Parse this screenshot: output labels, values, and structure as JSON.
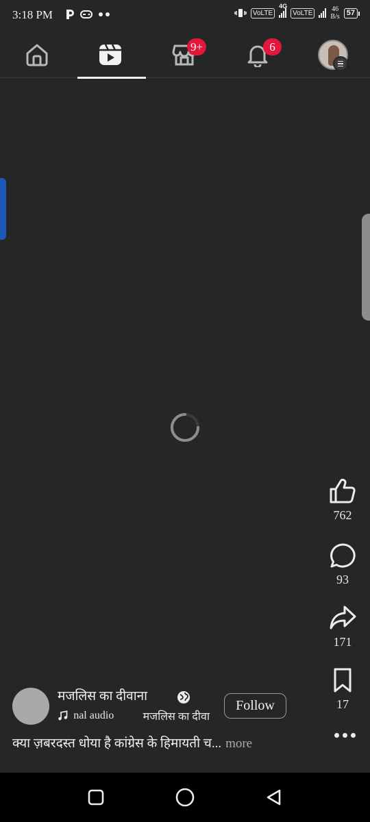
{
  "status_bar": {
    "time": "3:18 PM",
    "volte1": "VoLTE",
    "network_type": "4G",
    "volte2": "VoLTE",
    "speed_value": "46",
    "speed_unit": "B/s",
    "battery": "57"
  },
  "top_nav": {
    "tabs": [
      {
        "name": "home",
        "icon": "home-icon"
      },
      {
        "name": "reels",
        "icon": "reels-icon",
        "active": true
      },
      {
        "name": "marketplace",
        "icon": "marketplace-icon",
        "badge": "9+"
      },
      {
        "name": "notifications",
        "icon": "bell-icon",
        "badge": "6"
      },
      {
        "name": "profile",
        "icon": "avatar"
      }
    ]
  },
  "reel": {
    "loading": true,
    "actions": {
      "like_count": "762",
      "comment_count": "93",
      "share_count": "171",
      "save_count": "17"
    },
    "author": {
      "name": "मजलिस का दीवाना",
      "follow_label": "Follow"
    },
    "audio": {
      "label": "nal audio",
      "artist": "मजलिस का दीवा"
    },
    "caption": "क्या ज़बरदस्त धोया है कांग्रेस के हिमायती च...",
    "more_label": "more"
  },
  "colors": {
    "background": "#252628",
    "badge": "#e4163a",
    "edge_left": "#1f57b8"
  }
}
